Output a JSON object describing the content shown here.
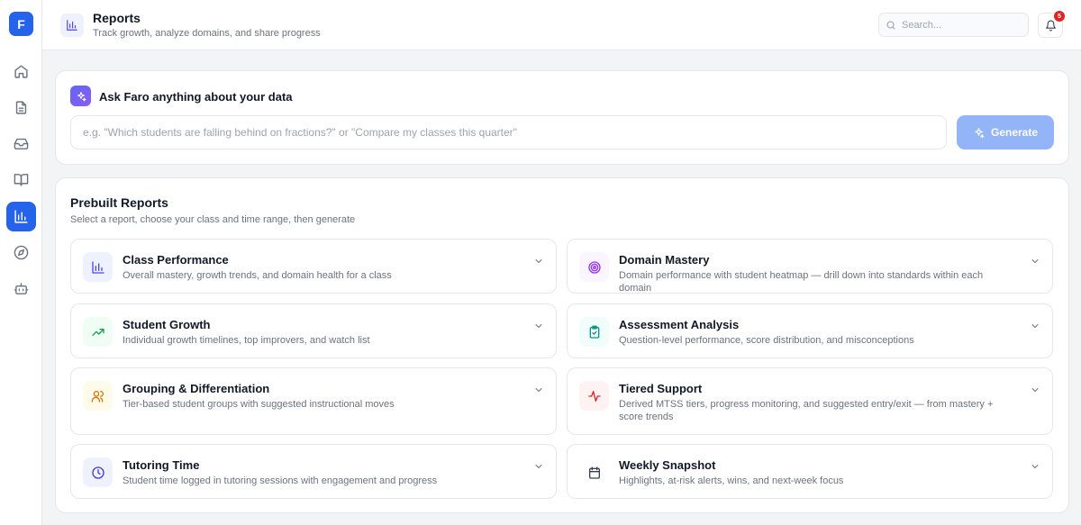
{
  "sidebar": {
    "logo_letter": "F",
    "items": [
      {
        "icon": "home-icon"
      },
      {
        "icon": "document-icon"
      },
      {
        "icon": "inbox-icon"
      },
      {
        "icon": "book-icon"
      },
      {
        "icon": "bar-chart-icon",
        "active": true
      },
      {
        "icon": "compass-icon"
      },
      {
        "icon": "bot-icon"
      }
    ]
  },
  "header": {
    "title": "Reports",
    "subtitle": "Track growth, analyze domains, and share progress",
    "search_placeholder": "Search...",
    "notification_count": "5"
  },
  "ask": {
    "title": "Ask Faro anything about your data",
    "placeholder": "e.g. \"Which students are falling behind on fractions?\" or \"Compare my classes this quarter\"",
    "generate_label": "Generate"
  },
  "prebuilt": {
    "title": "Prebuilt Reports",
    "subtitle": "Select a report, choose your class and time range, then generate",
    "reports": [
      {
        "title": "Class Performance",
        "description": "Overall mastery, growth trends, and domain health for a class",
        "icon": "bar-chart-icon",
        "color": "#4f46e5",
        "bg": "#eef2ff"
      },
      {
        "title": "Domain Mastery",
        "description": "Domain performance with student heatmap — drill down into standards within each domain",
        "icon": "target-icon",
        "color": "#9333ea",
        "bg": "#faf5ff"
      },
      {
        "title": "Student Growth",
        "description": "Individual growth timelines, top improvers, and watch list",
        "icon": "trending-up-icon",
        "color": "#16a34a",
        "bg": "#f0fdf4"
      },
      {
        "title": "Assessment Analysis",
        "description": "Question-level performance, score distribution, and misconceptions",
        "icon": "clipboard-check-icon",
        "color": "#0d9488",
        "bg": "#f0fdfa"
      },
      {
        "title": "Grouping & Differentiation",
        "description": "Tier-based student groups with suggested instructional moves",
        "icon": "users-icon",
        "color": "#d97706",
        "bg": "#fffbeb"
      },
      {
        "title": "Tiered Support",
        "description": "Derived MTSS tiers, progress monitoring, and suggested entry/exit — from mastery + score trends",
        "icon": "activity-icon",
        "color": "#dc2626",
        "bg": "#fef2f2"
      },
      {
        "title": "Tutoring Time",
        "description": "Student time logged in tutoring sessions with engagement and progress",
        "icon": "clock-icon",
        "color": "#4338ca",
        "bg": "#eef2ff"
      },
      {
        "title": "Weekly Snapshot",
        "description": "Highlights, at-risk alerts, wins, and next-week focus",
        "icon": "calendar-icon",
        "color": "#374151",
        "bg": "#ffffff"
      }
    ]
  }
}
